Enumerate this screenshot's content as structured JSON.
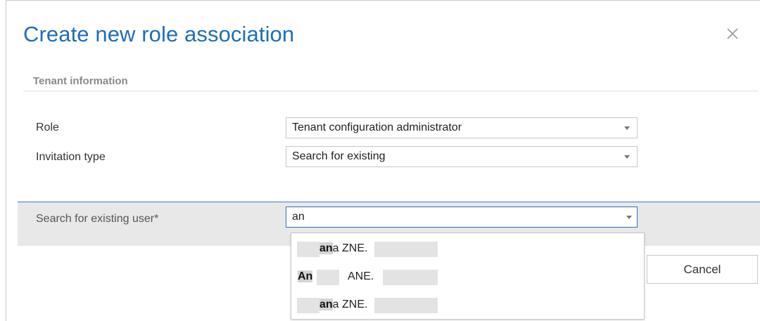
{
  "dialog": {
    "title": "Create new role association",
    "close_glyph": "×"
  },
  "section": {
    "header": "Tenant information"
  },
  "form": {
    "role_label": "Role",
    "role_value": "Tenant configuration administrator",
    "invitation_label": "Invitation type",
    "invitation_value": "Search for existing",
    "search_label": "Search for existing user",
    "search_required_mark": "*",
    "search_value": "an"
  },
  "suggestions": [
    {
      "match": "an",
      "rest": "a ZNE."
    },
    {
      "match": "An",
      "rest": "ANE."
    },
    {
      "match": "an",
      "rest": "a ZNE."
    }
  ],
  "buttons": {
    "cancel_label": "Cancel"
  },
  "colors": {
    "title": "#1f6eb8",
    "focus_border": "#2f6fb6",
    "band": "#e8e8e8"
  },
  "icons": {
    "close": "close-icon",
    "dropdown": "chevron-down-icon"
  }
}
